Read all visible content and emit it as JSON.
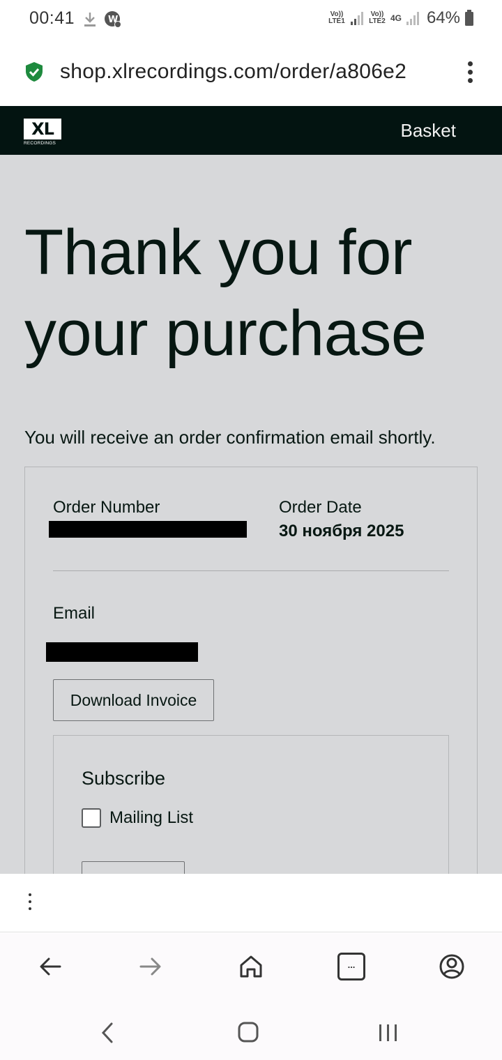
{
  "status_bar": {
    "time": "00:41",
    "sim1_label": "Vo)) LTE1",
    "sim2_label": "Vo)) LTE2",
    "network_type": "4G",
    "battery": "64%",
    "icons": [
      "download-icon",
      "whatsapp-business-icon",
      "signal-icon",
      "battery-icon"
    ]
  },
  "url_bar": {
    "url": "shop.xlrecordings.com/order/a806e2",
    "security_icon": "shield-check-icon",
    "menu_icon": "more-vertical-icon"
  },
  "site_header": {
    "logo_text": "XL",
    "logo_subtext": "RECORDINGS",
    "basket_label": "Basket"
  },
  "main": {
    "heading_line1": "Thank you for",
    "heading_line2": "your purchase",
    "subtext": "You will receive an order confirmation email shortly.",
    "order_number_label": "Order Number",
    "order_date_label": "Order Date",
    "order_date_value": "30 ноября 2025",
    "email_label": "Email",
    "download_invoice_label": "Download Invoice",
    "subscribe_title": "Subscribe",
    "mailing_list_label": "Mailing List",
    "mailing_list_checked": false
  },
  "browser_nav": {
    "icons": [
      "back-arrow-icon",
      "forward-arrow-icon",
      "home-icon",
      "tabs-icon",
      "account-icon"
    ],
    "tabs_badge": "..."
  },
  "colors": {
    "header_bg": "#031411",
    "page_bg": "#d7d8da",
    "text": "#071712",
    "shield": "#1e8a3e"
  }
}
